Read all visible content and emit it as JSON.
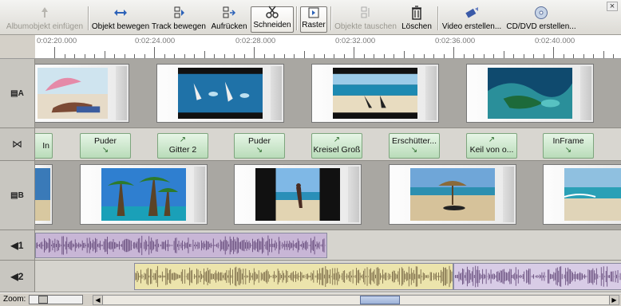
{
  "toolbar": {
    "album_add": "Albumobjekt einfügen",
    "move_object": "Objekt bewegen",
    "move_track": "Track bewegen",
    "ripple": "Aufrücken",
    "cut": "Schneiden",
    "grid": "Raster",
    "swap": "Objekte tauschen",
    "delete": "Löschen",
    "make_video": "Video erstellen...",
    "make_disc": "CD/DVD erstellen...",
    "close": "×"
  },
  "ruler": {
    "labels": [
      "0:02:20.000",
      "0:02:24.000",
      "0:02:28.000",
      "0:02:32.000",
      "0:02:36.000",
      "0:02:40.000"
    ]
  },
  "tracks": {
    "video_a": "A",
    "transitions": "⋈",
    "video_b": "B",
    "audio1": "◀1",
    "audio2": "◀2"
  },
  "transitions": [
    {
      "label": "In",
      "icon": ""
    },
    {
      "label": "Puder",
      "icon": "↘"
    },
    {
      "label": "Gitter 2",
      "icon": "↗"
    },
    {
      "label": "Puder",
      "icon": "↘"
    },
    {
      "label": "Kreisel Groß",
      "icon": "↗"
    },
    {
      "label": "Erschütter...",
      "icon": "↘"
    },
    {
      "label": "Keil von o...",
      "icon": "↗"
    },
    {
      "label": "InFrame",
      "icon": "↘"
    }
  ],
  "status": {
    "zoom_label": "Zoom:",
    "scroll_left": "◀",
    "scroll_right": "▶",
    "zoom_level": 0.2,
    "scroll_position": 0.55
  },
  "colors": {
    "transition_fill": "#b9dcb9",
    "audio1_fill": "#c8b6d6",
    "audio2_fill": "#ece4ac",
    "waveform": "#5a3e70"
  }
}
